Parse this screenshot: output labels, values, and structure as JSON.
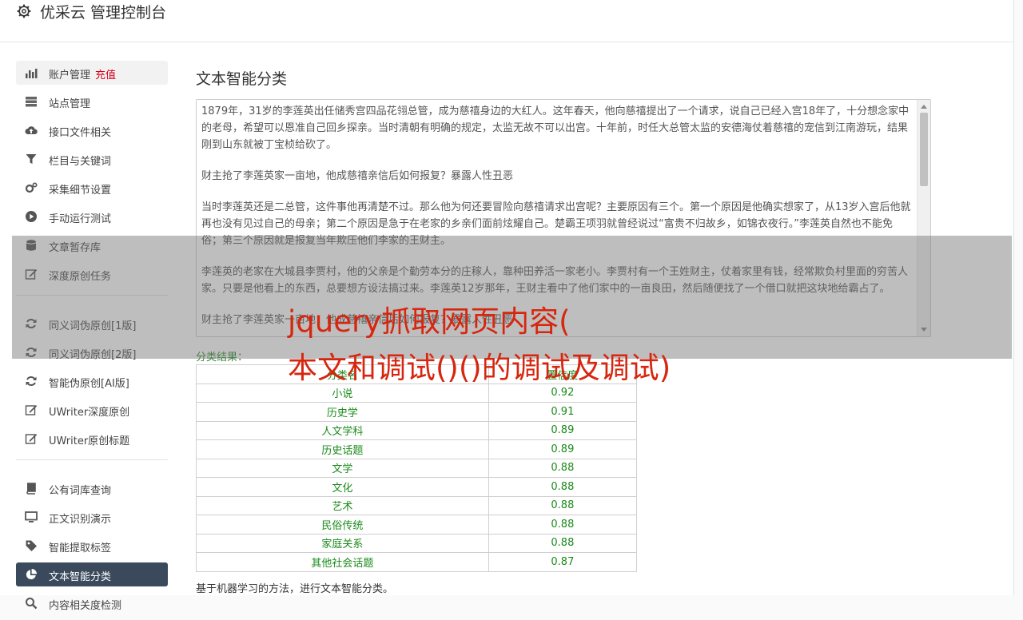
{
  "header": {
    "title": "优采云 管理控制台"
  },
  "sidebar": {
    "items": [
      {
        "label": "账户管理",
        "extra": "充值"
      },
      {
        "label": "站点管理"
      },
      {
        "label": "接口文件相关"
      },
      {
        "label": "栏目与关键词"
      },
      {
        "label": "采集细节设置"
      },
      {
        "label": "手动运行测试"
      },
      {
        "label": "文章暂存库"
      },
      {
        "label": "深度原创任务"
      },
      {
        "label": "同义词伪原创[1版]"
      },
      {
        "label": "同义词伪原创[2版]"
      },
      {
        "label": "智能伪原创[AI版]"
      },
      {
        "label": "UWriter深度原创"
      },
      {
        "label": "UWriter原创标题"
      },
      {
        "label": "公有词库查询"
      },
      {
        "label": "正文识别演示"
      },
      {
        "label": "智能提取标签"
      },
      {
        "label": "文本智能分类"
      },
      {
        "label": "内容相关度检测"
      }
    ]
  },
  "main": {
    "title": "文本智能分类",
    "paragraphs": [
      "1879年，31岁的李莲英出任储秀宫四品花翎总管，成为慈禧身边的大红人。这年春天，他向慈禧提出了一个请求，说自己已经入宫18年了，十分想念家中的老母，希望可以恩准自己回乡探亲。当时清朝有明确的规定，太监无故不可以出宫。十年前，时任大总管太监的安德海仗着慈禧的宠信到江南游玩，结果刚到山东就被丁宝桢给砍了。",
      "财主抢了李莲英家一亩地，他成慈禧亲信后如何报复？暴露人性丑恶",
      "当时李莲英还是二总管，这件事他再清楚不过。那么他为何还要冒险向慈禧请求出宫呢？主要原因有三个。第一个原因是他确实想家了，从13岁入宫后他就再也没有见过自己的母亲；第二个原因是急于在老家的乡亲们面前炫耀自己。楚霸王项羽就曾经说过“富贵不归故乡，如锦衣夜行。”李莲英自然也不能免俗；第三个原因就是报复当年欺压他们李家的王财主。",
      "李莲英的老家在大城县李贾村，他的父亲是个勤劳本分的庄稼人，靠种田养活一家老小。李贾村有一个王姓财主，仗着家里有钱，经常欺负村里面的穷苦人家。只要是他看上的东西，总要想方设法搞过来。李莲英12岁那年，王财主看中了他们家中的一亩良田，然后随便找了一个借口就把这块地给霸占了。",
      "财主抢了李莲英家一亩地，他成慈禧亲信后如何报复？暴露人性丑恶"
    ],
    "result_label": "分类结果：",
    "table": {
      "headers": [
        "分类名",
        "置信度"
      ],
      "rows": [
        [
          "小说",
          "0.92"
        ],
        [
          "历史学",
          "0.91"
        ],
        [
          "人文学科",
          "0.89"
        ],
        [
          "历史话题",
          "0.89"
        ],
        [
          "文学",
          "0.88"
        ],
        [
          "文化",
          "0.88"
        ],
        [
          "艺术",
          "0.88"
        ],
        [
          "民俗传统",
          "0.88"
        ],
        [
          "家庭关系",
          "0.88"
        ],
        [
          "其他社会话题",
          "0.87"
        ]
      ]
    },
    "footnote": "基于机器学习的方法，进行文本智能分类。"
  },
  "overlay": {
    "line1": "jquery抓取网页内容(",
    "line2": "本文和调试()()的调试及调试)"
  },
  "colors": {
    "accent": "#d7260f",
    "active_nav": "#3a4a5c",
    "result_green": "#1a8a1a",
    "recharge_red": "#d9001b"
  }
}
